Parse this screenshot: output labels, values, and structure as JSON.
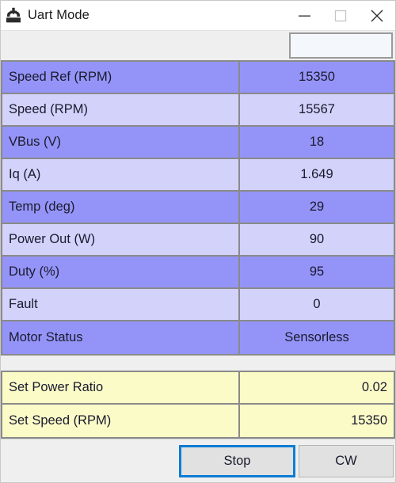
{
  "window": {
    "title": "Uart Mode",
    "icon": "install-tray-icon",
    "controls": [
      {
        "name": "minimize-button",
        "glyph": "minimize-icon"
      },
      {
        "name": "maximize-button",
        "glyph": "maximize-icon"
      },
      {
        "name": "close-button",
        "glyph": "close-icon"
      }
    ]
  },
  "toolbar": {
    "input_value": "",
    "input_placeholder": ""
  },
  "status_table": {
    "rows": [
      {
        "label": "Speed Ref (RPM)",
        "value": "15350"
      },
      {
        "label": "Speed (RPM)",
        "value": "15567"
      },
      {
        "label": "VBus (V)",
        "value": "18"
      },
      {
        "label": "Iq (A)",
        "value": "1.649"
      },
      {
        "label": "Temp (deg)",
        "value": "29"
      },
      {
        "label": "Power Out (W)",
        "value": "90"
      },
      {
        "label": "Duty (%)",
        "value": "95"
      },
      {
        "label": "Fault",
        "value": "0"
      },
      {
        "label": "Motor Status",
        "value": "Sensorless"
      }
    ]
  },
  "set_table": {
    "rows": [
      {
        "label": "Set Power Ratio",
        "value": "0.02"
      },
      {
        "label": "Set Speed (RPM)",
        "value": "15350"
      }
    ]
  },
  "buttons": {
    "stop_label": "Stop",
    "cw_label": "CW"
  },
  "colors": {
    "row_dark": "#9494f8",
    "row_light": "#d2d2fb",
    "set_row": "#fbfbc8",
    "focus_border": "#0c7cd5",
    "grid_line": "#8a8a8a",
    "chrome": "#efefef"
  }
}
